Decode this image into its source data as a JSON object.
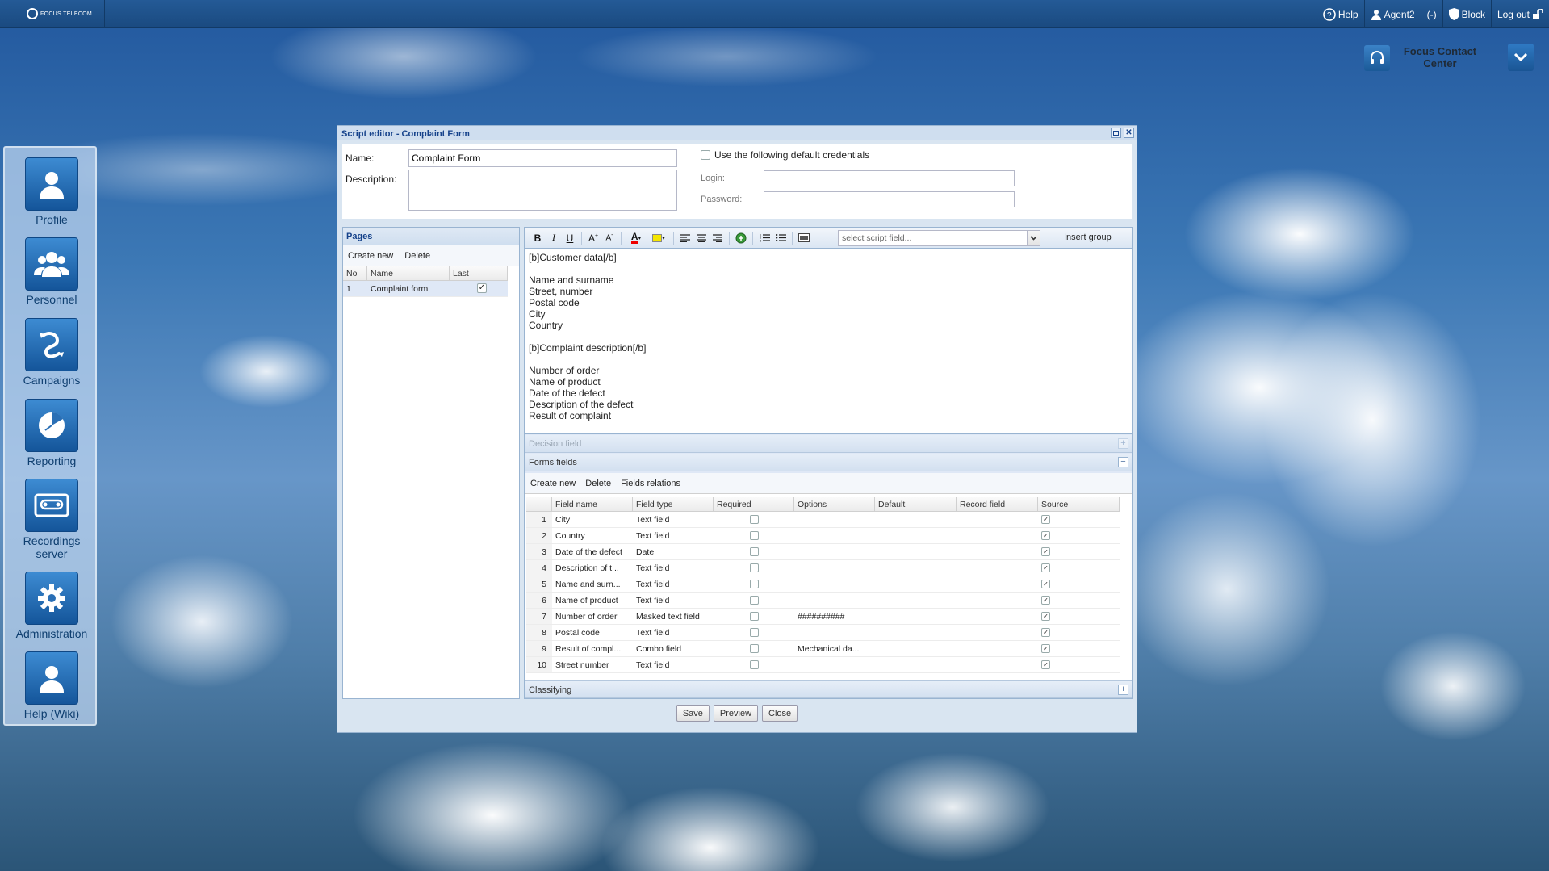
{
  "topbar": {
    "logo_text": "FOCUS TELECOM",
    "help": "Help",
    "agent": "Agent2",
    "status": "(-)",
    "block": "Block",
    "logout": "Log out"
  },
  "contact_center": {
    "line1": "Focus Contact",
    "line2": "Center"
  },
  "sidebar": {
    "items": [
      {
        "label": "Profile",
        "icon": "user-icon"
      },
      {
        "label": "Personnel",
        "icon": "people-icon"
      },
      {
        "label": "Campaigns",
        "icon": "campaigns-icon"
      },
      {
        "label": "Reporting",
        "icon": "pie-chart-icon"
      },
      {
        "label": "Recordings",
        "label2": "server",
        "icon": "cassette-icon"
      },
      {
        "label": "Administration",
        "icon": "gear-icon"
      },
      {
        "label": "Help (Wiki)",
        "icon": "user-icon"
      }
    ]
  },
  "window": {
    "title": "Script editor - Complaint Form",
    "name_label": "Name:",
    "name_value": "Complaint Form",
    "description_label": "Description:",
    "description_value": "",
    "credentials_label": "Use the following default credentials",
    "login_label": "Login:",
    "password_label": "Password:"
  },
  "pages": {
    "title": "Pages",
    "create_new": "Create new",
    "delete": "Delete",
    "columns": [
      "No",
      "Name",
      "Last"
    ],
    "rows": [
      {
        "no": "1",
        "name": "Complaint form",
        "last": true
      }
    ]
  },
  "editor": {
    "select_placeholder": "select script field...",
    "insert_group": "Insert group",
    "content": "[b]Customer data[/b]\n\nName and surname\nStreet, number\nPostal code\nCity\nCountry\n\n[b]Complaint description[/b]\n\nNumber of order\nName of product\nDate of the defect\nDescription of the defect\nResult of complaint"
  },
  "decision_field": "Decision field",
  "forms_fields": {
    "title": "Forms fields",
    "create_new": "Create new",
    "delete": "Delete",
    "fields_relations": "Fields relations",
    "columns": [
      "Field name",
      "Field type",
      "Required",
      "Options",
      "Default",
      "Record field",
      "Source"
    ],
    "rows": [
      {
        "no": "1",
        "name": "City",
        "type": "Text field",
        "options": ""
      },
      {
        "no": "2",
        "name": "Country",
        "type": "Text field",
        "options": ""
      },
      {
        "no": "3",
        "name": "Date of the defect",
        "type": "Date",
        "options": ""
      },
      {
        "no": "4",
        "name": "Description of t...",
        "type": "Text field",
        "options": ""
      },
      {
        "no": "5",
        "name": "Name and surn...",
        "type": "Text field",
        "options": ""
      },
      {
        "no": "6",
        "name": "Name of product",
        "type": "Text field",
        "options": ""
      },
      {
        "no": "7",
        "name": "Number of order",
        "type": "Masked text field",
        "options": "##########"
      },
      {
        "no": "8",
        "name": "Postal code",
        "type": "Text field",
        "options": ""
      },
      {
        "no": "9",
        "name": "Result of compl...",
        "type": "Combo field",
        "options": "Mechanical da..."
      },
      {
        "no": "10",
        "name": "Street number",
        "type": "Text field",
        "options": ""
      }
    ]
  },
  "classifying": "Classifying",
  "buttons": {
    "save": "Save",
    "preview": "Preview",
    "close": "Close"
  }
}
